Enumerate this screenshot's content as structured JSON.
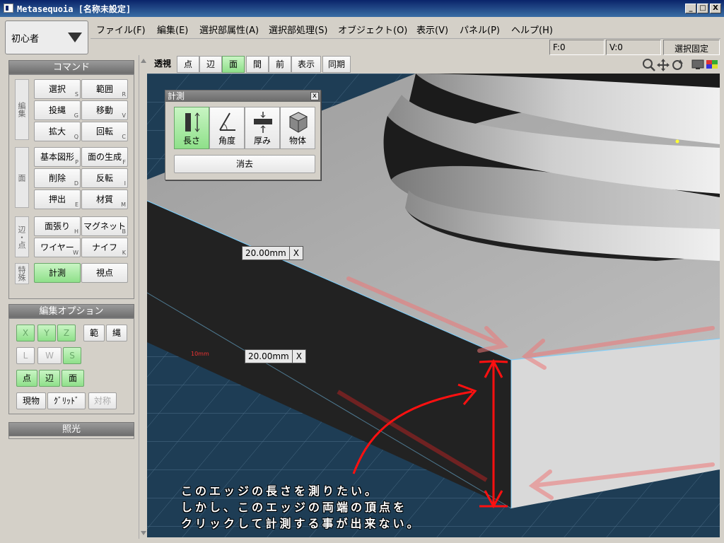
{
  "window": {
    "title": "Metasequoia [名称未設定]",
    "min": "_",
    "max": "□",
    "close": "X"
  },
  "mode": {
    "label": "初心者"
  },
  "menu": [
    "ファイル(F)",
    "編集(E)",
    "選択部属性(A)",
    "選択部処理(S)",
    "オブジェクト(O)",
    "表示(V)",
    "パネル(P)",
    "ヘルプ(H)"
  ],
  "status": {
    "faces": "F:0",
    "vertices": "V:0",
    "lock": "選択固定"
  },
  "command_panel": {
    "title": "コマンド",
    "groups": {
      "edit": "編集",
      "face": "面",
      "edge": "辺・点",
      "special": "特殊"
    },
    "buttons": {
      "select": {
        "label": "選択",
        "key": "S"
      },
      "range": {
        "label": "範囲",
        "key": "R"
      },
      "lasso": {
        "label": "投縄",
        "key": "G"
      },
      "move": {
        "label": "移動",
        "key": "V"
      },
      "scale": {
        "label": "拡大",
        "key": "Q"
      },
      "rotate": {
        "label": "回転",
        "key": "C"
      },
      "primitive": {
        "label": "基本図形",
        "key": "P"
      },
      "face_gen": {
        "label": "面の生成",
        "key": "F"
      },
      "delete": {
        "label": "削除",
        "key": "D"
      },
      "flip": {
        "label": "反転",
        "key": "I"
      },
      "extrude": {
        "label": "押出",
        "key": "E"
      },
      "material": {
        "label": "材質",
        "key": "M"
      },
      "face_stretch": {
        "label": "面張り",
        "key": "H"
      },
      "magnet": {
        "label": "マグネット",
        "key": "B"
      },
      "wire": {
        "label": "ワイヤー",
        "key": "W"
      },
      "knife": {
        "label": "ナイフ",
        "key": "K"
      },
      "measure": {
        "label": "計測"
      },
      "view": {
        "label": "視点"
      }
    }
  },
  "edit_options": {
    "title": "編集オプション",
    "x": "X",
    "y": "Y",
    "z": "Z",
    "range": "範",
    "rope": "縄",
    "local": "L",
    "world": "W",
    "screen": "S",
    "point": "点",
    "edge": "辺",
    "face": "面",
    "current": "現物",
    "grid": "ｸﾞﾘｯﾄﾞ",
    "symmetry": "対称"
  },
  "lighting": {
    "title": "照光"
  },
  "view_toolbar": [
    "透視",
    "点",
    "辺",
    "面",
    "間",
    "前",
    "表示",
    "同期"
  ],
  "measure_dialog": {
    "title": "計測",
    "close": "x",
    "tools": [
      "長さ",
      "角度",
      "厚み",
      "物体"
    ],
    "clear": "消去"
  },
  "measure_tags": [
    {
      "value": "20.00mm",
      "close": "X"
    },
    {
      "value": "20.00mm",
      "close": "X"
    }
  ],
  "grid_label": "10mm",
  "annotation": [
    "このエッジの長さを測りたい。",
    "しかし、このエッジの両端の頂点を",
    "クリックして計測する事が出来ない。"
  ],
  "colors": {
    "active_green": "#8fe08a",
    "grid_bg": "#1f3a52",
    "arrow_red": "#e01010"
  }
}
